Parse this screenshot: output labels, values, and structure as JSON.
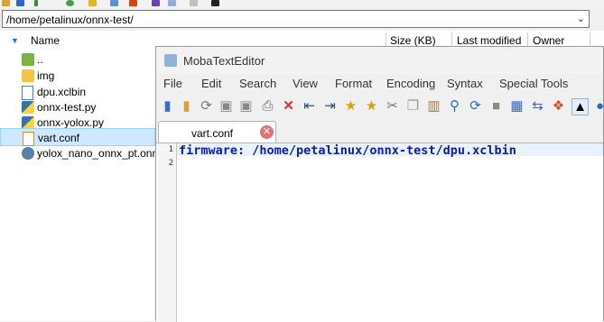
{
  "browser": {
    "path": "/home/petalinux/onnx-test/",
    "columns": {
      "name": "Name",
      "size": "Size (KB)",
      "modified": "Last modified",
      "owner": "Owner"
    },
    "files": [
      {
        "name": "..",
        "icon": "folder-up-icon"
      },
      {
        "name": "img",
        "icon": "folder-icon"
      },
      {
        "name": "dpu.xclbin",
        "icon": "file-icon"
      },
      {
        "name": "onnx-test.py",
        "icon": "python-file-icon"
      },
      {
        "name": "onnx-yolox.py",
        "icon": "python-file-icon"
      },
      {
        "name": "vart.conf",
        "icon": "config-file-icon",
        "selected": true
      },
      {
        "name": "yolox_nano_onnx_pt.onnx",
        "icon": "onnx-file-icon"
      }
    ]
  },
  "editor": {
    "title": "MobaTextEditor",
    "menu": [
      "File",
      "Edit",
      "Search",
      "View",
      "Format",
      "Encoding",
      "Syntax",
      "Special Tools"
    ],
    "tab": {
      "label": "vart.conf"
    },
    "lines": [
      {
        "number": "1",
        "text": "firmware: /home/petalinux/onnx-test/dpu.xclbin"
      },
      {
        "number": "2",
        "text": ""
      }
    ]
  }
}
